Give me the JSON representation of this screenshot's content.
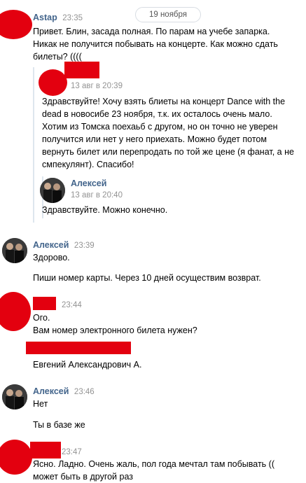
{
  "date_divider": "19 ноября",
  "messages": [
    {
      "author": "Astap",
      "time": "23:35",
      "lines": [
        "Привет. Блин, засада полная. По парам на учебе запарка.",
        "Никак не получится побывать на концерте. Как можно сдать",
        "билеты? (((("
      ],
      "forwarded": {
        "time": "13 авг в 20:39",
        "lines": [
          "Здравствуйте! Хочу взять блиеты на концерт Dance with the",
          "dead в новосибе 23 ноября, т.к. их осталось очень мало.",
          "Хотим из Томска поехаьб с другом, но он точно не уверен",
          "получится или нет у него приехать. Можно будет потом",
          "вернуть билет или перепродать по той же цене (я фанат, а не",
          "смпекулянт). Спасибо!"
        ],
        "reply": {
          "author": "Алексей",
          "time": "13 авг в 20:40",
          "text": "Здравствуйте. Можно конечно."
        }
      }
    },
    {
      "author": "Алексей",
      "time": "23:39",
      "lines": [
        "Здорово.",
        "Пиши номер карты. Через 10 дней осуществим возврат."
      ]
    },
    {
      "time": "23:44",
      "lines": [
        "Ого.",
        "Вам номер электронного билета нужен?",
        "Евгений Александрович А."
      ]
    },
    {
      "author": "Алексей",
      "time": "23:46",
      "lines": [
        "Нет",
        "Ты в базе же"
      ]
    },
    {
      "time": "23:47",
      "lines": [
        "Ясно. Ладно. Очень жаль, пол года мечтал там побывать ((",
        "может быть в другой раз"
      ]
    }
  ],
  "colors": {
    "redaction": "#e3000f",
    "author_name": "#42648b",
    "timestamp": "#939393"
  }
}
